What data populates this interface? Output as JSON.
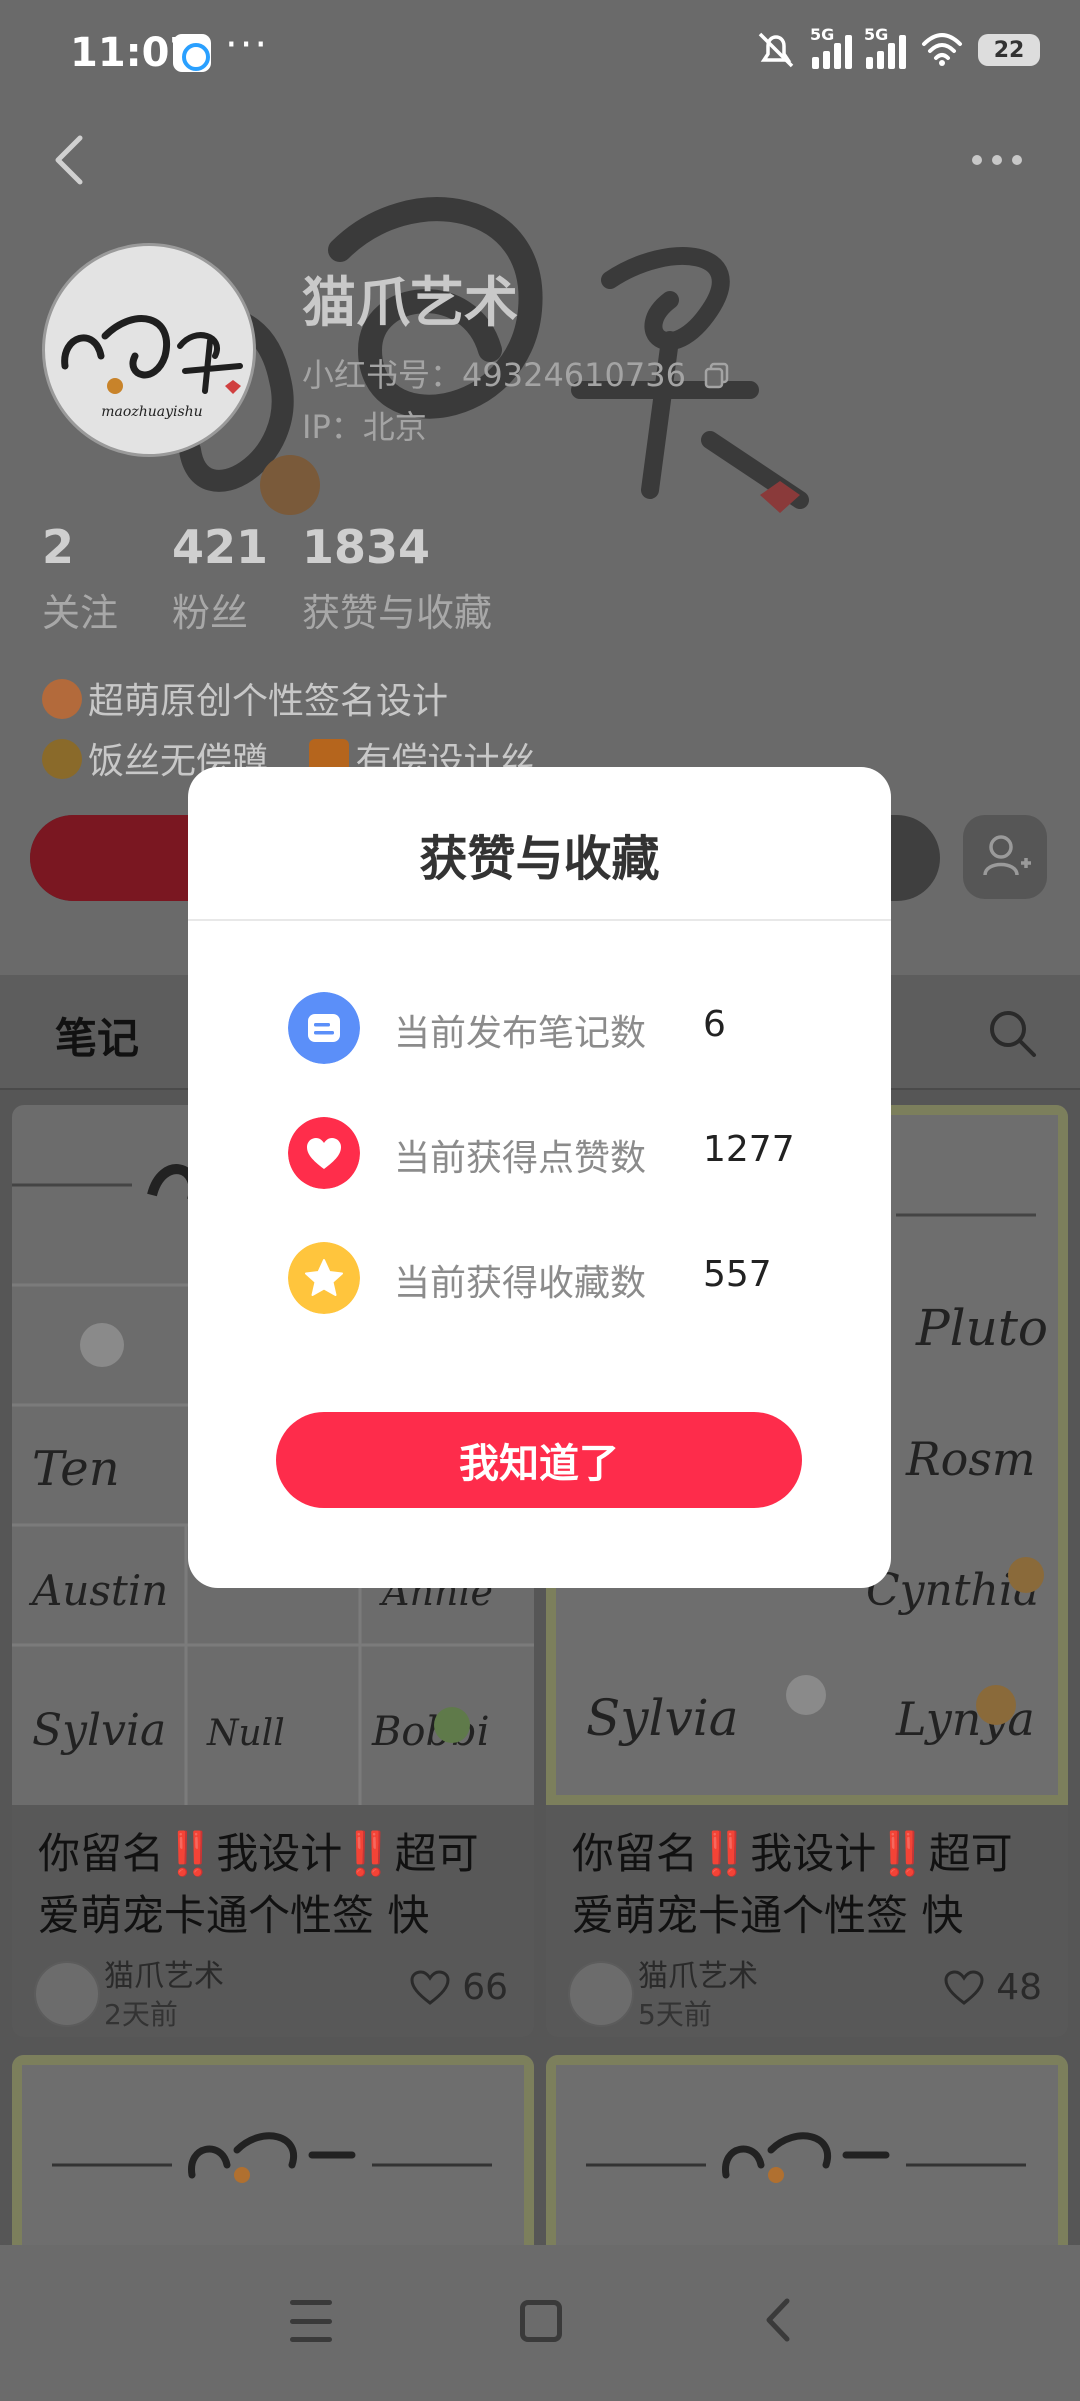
{
  "status_bar": {
    "time": "11:07",
    "dots": "···",
    "network_1": "5G",
    "network_2": "5G",
    "battery": "22"
  },
  "profile": {
    "name": "猫爪艺术",
    "xhs_id": "小红书号：49324610736",
    "ip": "IP：北京",
    "stats": [
      {
        "num": "2",
        "label": "关注"
      },
      {
        "num": "421",
        "label": "粉丝"
      },
      {
        "num": "1834",
        "label": "获赞与收藏"
      }
    ],
    "bio_line1": "超萌原创个性签名设计",
    "bio_line2": "饭丝无偿蹲",
    "bio_line2_tail": "有偿设计丝",
    "avatar_text": "maozhuayishu"
  },
  "tabs": {
    "notes": "笔记"
  },
  "cards": [
    {
      "title": "你留名‼️我设计‼️超可爱萌宠卡通个性签 快",
      "author": "猫爪艺术",
      "time": "2天前",
      "likes": "66"
    },
    {
      "title": "你留名‼️我设计‼️超可爱萌宠卡通个性签 快",
      "author": "猫爪艺术",
      "time": "5天前",
      "likes": "48"
    }
  ],
  "thumb_names_left": [
    "Austin",
    "Ten",
    "Sylvia",
    "Null",
    "Bobbi",
    "Annie"
  ],
  "thumb_names_right": [
    "Pluto",
    "Rosm",
    "Cynthia",
    "Sylvia",
    "Lynya"
  ],
  "modal": {
    "title": "获赞与收藏",
    "rows": [
      {
        "label": "当前发布笔记数",
        "value": "6",
        "color": "#5b8ff9"
      },
      {
        "label": "当前获得点赞数",
        "value": "1277",
        "color": "#ff2d4b"
      },
      {
        "label": "当前获得收藏数",
        "value": "557",
        "color": "#ffc53d"
      }
    ],
    "button": "我知道了"
  }
}
